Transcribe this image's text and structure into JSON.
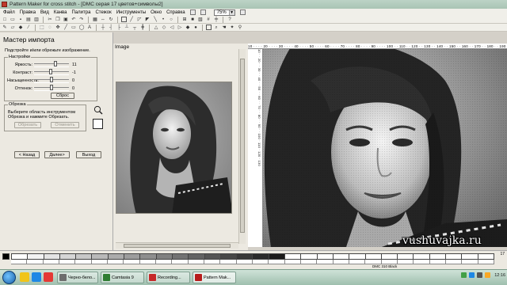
{
  "window": {
    "title": "Pattern Maker for cross stitch - [DMC серая 17 цветов+символы2]"
  },
  "menu": {
    "items": [
      "Файл",
      "Правка",
      "Вид",
      "Канва",
      "Палитра",
      "Стежок",
      "Инструменты",
      "Окно",
      "Справка"
    ],
    "zoom": "75%"
  },
  "wizard": {
    "title": "Мастер импорта",
    "subtitle": "Подстройте и/или обрежьте изображение.",
    "settings_group": "Настройки",
    "brightness_label": "Яркость:",
    "brightness_value": "11",
    "brightness_level": 0.62,
    "contrast_label": "Контраст:",
    "contrast_value": "-1",
    "contrast_level": 0.48,
    "saturation_label": "Насыщенность:",
    "saturation_value": "0",
    "saturation_level": 0.5,
    "hue_label": "Оттенок:",
    "hue_value": "0",
    "hue_level": 0.5,
    "reset_label": "Сброс",
    "crop_group": "Обрезка",
    "crop_hint": "Выберите область инструментом Обрезка и нажмите Обрезать.",
    "crop_button": "Обрезать",
    "cancel_crop_button": "Отменить",
    "back_button": "< Назад",
    "next_button": "Далее>",
    "exit_button": "Выход"
  },
  "image_panel": {
    "label": "Image"
  },
  "ruler": {
    "top": "10 · · · · 20 · · · · 30 · · · · 40 · · · · 50 · · · · 60 · · · · 70 · · · · 80 · · · · 90 · · · · 100 · · 110 · · 120 · · 130 · · 140 · · 150 · · 160 · · 170 · · 180 · · 190 · · 20",
    "left": "10 · · 20 · · 30 · · 40 · · 50 · · 60 · · 70 · · 80 · · 90 · · 100 · 110 · 120 · 130"
  },
  "palette": {
    "count": "17",
    "colors": [
      "#ffffff",
      "#f2f2f2",
      "#e4e4e4",
      "#d6d6d6",
      "#c8c8c8",
      "#b9b9b9",
      "#ababab",
      "#9d9d9d",
      "#8e8e8e",
      "#808080",
      "#727272",
      "#636363",
      "#555555",
      "#474747",
      "#383838",
      "#2a2a2a",
      "#1b1b1b"
    ]
  },
  "status": {
    "text": "DMC   310   Black"
  },
  "taskbar": {
    "tasks": [
      "Черно-бело...",
      "Camtasia 9",
      "Recording...",
      "Pattern Mak..."
    ],
    "clock": "12:16"
  },
  "watermark": "vushuvajka.ru"
}
